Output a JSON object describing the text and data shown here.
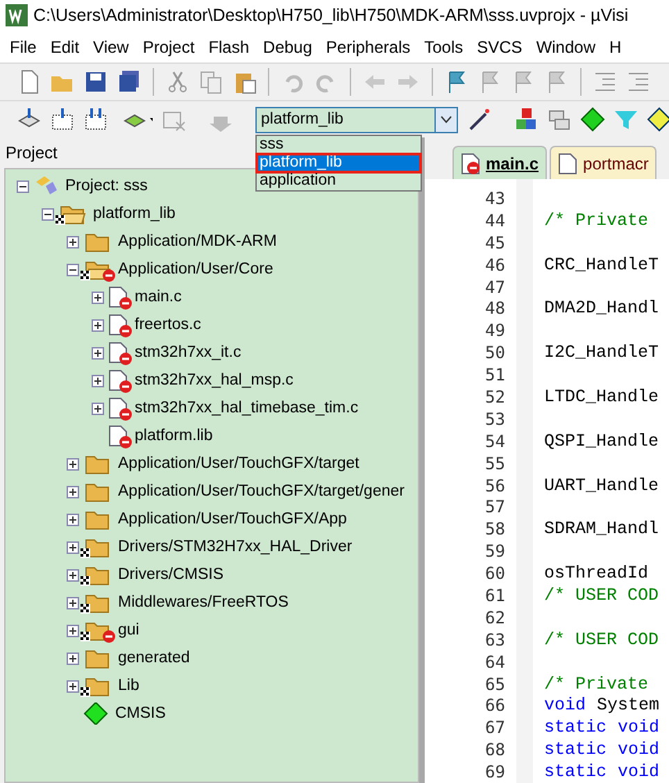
{
  "window": {
    "title": "C:\\Users\\Administrator\\Desktop\\H750_lib\\H750\\MDK-ARM\\sss.uvprojx - µVisi"
  },
  "menu": [
    "File",
    "Edit",
    "View",
    "Project",
    "Flash",
    "Debug",
    "Peripherals",
    "Tools",
    "SVCS",
    "Window",
    "H"
  ],
  "target_select": {
    "value": "platform_lib",
    "expanded": true,
    "options": [
      {
        "label": "sss",
        "selected": false
      },
      {
        "label": "platform_lib",
        "selected": true
      },
      {
        "label": "application",
        "selected": false
      }
    ]
  },
  "project_panel": {
    "title": "Project",
    "tree": [
      {
        "kind": "project",
        "label": "Project: sss",
        "expanded": true,
        "children": [
          {
            "kind": "open-folder",
            "label": "platform_lib",
            "expanded": true,
            "options": true,
            "excluded": false,
            "children": [
              {
                "kind": "folder",
                "label": "Application/MDK-ARM",
                "expanded": false,
                "options": false,
                "excluded": false
              },
              {
                "kind": "open-folder",
                "label": "Application/User/Core",
                "expanded": true,
                "options": true,
                "excluded": true,
                "children": [
                  {
                    "kind": "file",
                    "label": "main.c",
                    "expanded": false,
                    "options": false,
                    "excluded": true
                  },
                  {
                    "kind": "file",
                    "label": "freertos.c",
                    "expanded": false,
                    "options": false,
                    "excluded": true
                  },
                  {
                    "kind": "file",
                    "label": "stm32h7xx_it.c",
                    "expanded": false,
                    "options": false,
                    "excluded": true
                  },
                  {
                    "kind": "file",
                    "label": "stm32h7xx_hal_msp.c",
                    "expanded": false,
                    "options": false,
                    "excluded": true
                  },
                  {
                    "kind": "file",
                    "label": "stm32h7xx_hal_timebase_tim.c",
                    "expanded": false,
                    "options": false,
                    "excluded": true
                  },
                  {
                    "kind": "file",
                    "label": "platform.lib",
                    "options": false,
                    "excluded": true
                  }
                ]
              },
              {
                "kind": "folder",
                "label": "Application/User/TouchGFX/target",
                "expanded": false,
                "options": false,
                "excluded": false
              },
              {
                "kind": "folder",
                "label": "Application/User/TouchGFX/target/gener",
                "expanded": false,
                "options": false,
                "excluded": false
              },
              {
                "kind": "folder",
                "label": "Application/User/TouchGFX/App",
                "expanded": false,
                "options": false,
                "excluded": false
              },
              {
                "kind": "folder",
                "label": "Drivers/STM32H7xx_HAL_Driver",
                "expanded": false,
                "options": true,
                "excluded": false
              },
              {
                "kind": "folder",
                "label": "Drivers/CMSIS",
                "expanded": false,
                "options": true,
                "excluded": false
              },
              {
                "kind": "folder",
                "label": "Middlewares/FreeRTOS",
                "expanded": false,
                "options": true,
                "excluded": false
              },
              {
                "kind": "folder",
                "label": "gui",
                "expanded": false,
                "options": true,
                "excluded": true
              },
              {
                "kind": "folder",
                "label": "generated",
                "expanded": false,
                "options": false,
                "excluded": false
              },
              {
                "kind": "folder",
                "label": "Lib",
                "expanded": false,
                "options": true,
                "excluded": false
              },
              {
                "kind": "component",
                "label": "CMSIS",
                "options": false,
                "excluded": false
              }
            ]
          }
        ]
      }
    ]
  },
  "editor_tabs": [
    {
      "label": "main.c",
      "selected": true,
      "excluded": true
    },
    {
      "label": "portmacr",
      "selected": false,
      "excluded": false
    }
  ],
  "code": [
    {
      "number": "43"
    },
    {
      "number": "44",
      "tokens": [
        {
          "kind": "comment",
          "text": "/* Private"
        }
      ]
    },
    {
      "number": "45"
    },
    {
      "number": "46",
      "tokens": [
        {
          "kind": "plain",
          "text": "CRC_HandleT"
        }
      ]
    },
    {
      "number": "47"
    },
    {
      "number": "48",
      "tokens": [
        {
          "kind": "plain",
          "text": "DMA2D_Handl"
        }
      ]
    },
    {
      "number": "49"
    },
    {
      "number": "50",
      "tokens": [
        {
          "kind": "plain",
          "text": "I2C_HandleT"
        }
      ]
    },
    {
      "number": "51"
    },
    {
      "number": "52",
      "tokens": [
        {
          "kind": "plain",
          "text": "LTDC_Handle"
        }
      ]
    },
    {
      "number": "53"
    },
    {
      "number": "54",
      "tokens": [
        {
          "kind": "plain",
          "text": "QSPI_Handle"
        }
      ]
    },
    {
      "number": "55"
    },
    {
      "number": "56",
      "tokens": [
        {
          "kind": "plain",
          "text": "UART_Handle"
        }
      ]
    },
    {
      "number": "57"
    },
    {
      "number": "58",
      "tokens": [
        {
          "kind": "plain",
          "text": "SDRAM_Handl"
        }
      ]
    },
    {
      "number": "59"
    },
    {
      "number": "60",
      "tokens": [
        {
          "kind": "plain",
          "text": "osThreadId"
        }
      ]
    },
    {
      "number": "61",
      "tokens": [
        {
          "kind": "comment",
          "text": "/* USER COD"
        }
      ]
    },
    {
      "number": "62"
    },
    {
      "number": "63",
      "tokens": [
        {
          "kind": "comment",
          "text": "/* USER COD"
        }
      ]
    },
    {
      "number": "64"
    },
    {
      "number": "65",
      "tokens": [
        {
          "kind": "comment",
          "text": "/* Private"
        }
      ]
    },
    {
      "number": "66",
      "tokens": [
        {
          "kind": "keyword",
          "text": "void"
        },
        {
          "kind": "plain",
          "text": "System"
        }
      ]
    },
    {
      "number": "67",
      "tokens": [
        {
          "kind": "keyword",
          "text": "static"
        },
        {
          "kind": "keyword",
          "text": "void"
        }
      ]
    },
    {
      "number": "68",
      "tokens": [
        {
          "kind": "keyword",
          "text": "static"
        },
        {
          "kind": "keyword",
          "text": "void"
        }
      ]
    },
    {
      "number": "69",
      "tokens": [
        {
          "kind": "keyword",
          "text": "static"
        },
        {
          "kind": "keyword",
          "text": "void"
        }
      ]
    }
  ]
}
